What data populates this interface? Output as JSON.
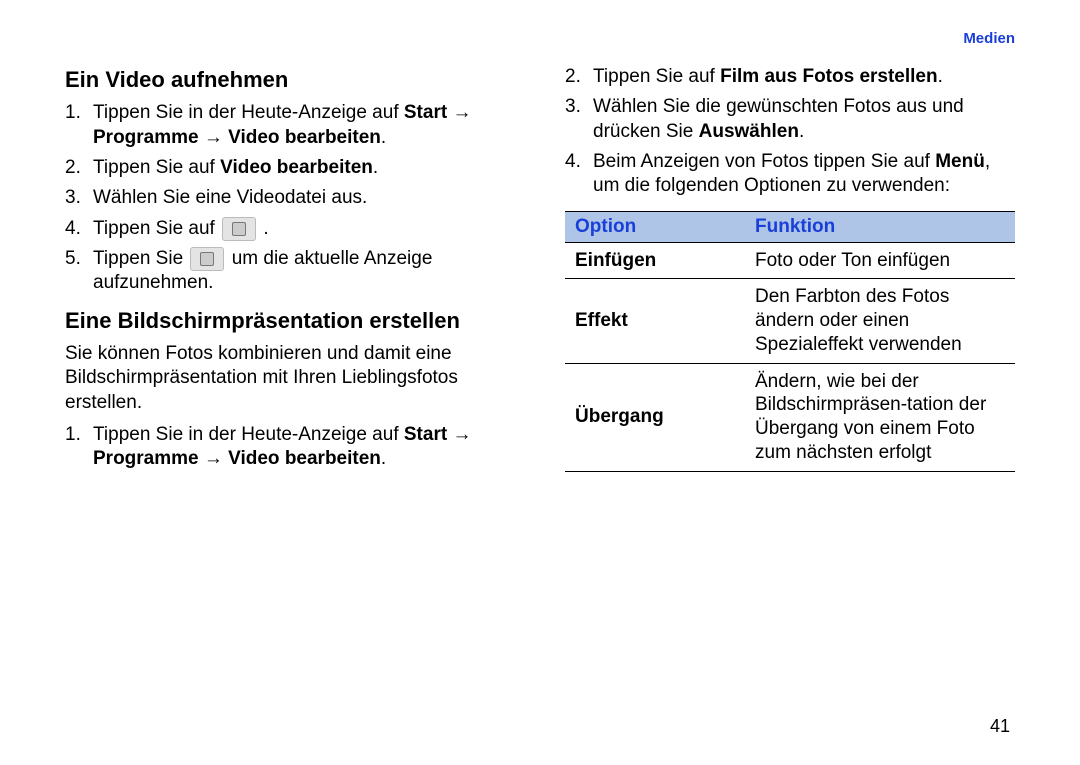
{
  "header": "Medien",
  "page_number": "41",
  "left": {
    "section1_title": "Ein Video aufnehmen",
    "s1_step1_a": "Tippen Sie in der Heute-Anzeige auf ",
    "s1_step1_b": "Start → Programme → Video bearbeiten",
    "s1_step1_c": ".",
    "s1_step2_a": "Tippen Sie auf ",
    "s1_step2_b": "Video bearbeiten",
    "s1_step2_c": ".",
    "s1_step3": "Wählen Sie eine Videodatei aus.",
    "s1_step4_a": "Tippen Sie auf ",
    "s1_step4_b": " .",
    "s1_step5_a": "Tippen Sie ",
    "s1_step5_b": " um die aktuelle Anzeige aufzunehmen.",
    "section2_title": "Eine Bildschirmpräsentation erstellen",
    "s2_intro": "Sie können Fotos kombinieren und damit eine Bildschirmpräsentation mit Ihren Lieblingsfotos erstellen.",
    "s2_step1_a": "Tippen Sie in der Heute-Anzeige auf ",
    "s2_step1_b": "Start → Programme → Video bearbeiten",
    "s2_step1_c": "."
  },
  "right": {
    "s2_step2_a": "Tippen Sie auf ",
    "s2_step2_b": "Film aus Fotos erstellen",
    "s2_step2_c": ".",
    "s2_step3_a": "Wählen Sie die gewünschten Fotos aus und drücken Sie ",
    "s2_step3_b": "Auswählen",
    "s2_step3_c": ".",
    "s2_step4_a": "Beim Anzeigen von Fotos tippen Sie auf ",
    "s2_step4_b": "Menü",
    "s2_step4_c": ", um die folgenden Optionen zu verwenden:",
    "table": {
      "head_option": "Option",
      "head_function": "Funktion",
      "rows": [
        {
          "option": "Einfügen",
          "function": "Foto oder Ton einfügen"
        },
        {
          "option": "Effekt",
          "function": "Den Farbton des Fotos ändern oder einen Spezialeffekt verwenden"
        },
        {
          "option": "Übergang",
          "function": "Ändern, wie bei der Bildschirmpräsen-tation der Übergang von einem Foto zum nächsten erfolgt"
        }
      ]
    }
  }
}
